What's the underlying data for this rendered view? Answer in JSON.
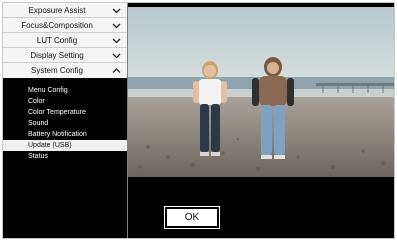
{
  "menu": {
    "items": [
      {
        "label": "Exposure Assist",
        "chevron": "chevron-down-icon"
      },
      {
        "label": "Focus&Composition",
        "chevron": "chevron-down-icon"
      },
      {
        "label": "LUT Config",
        "chevron": "chevron-down-icon"
      },
      {
        "label": "Display Setting",
        "chevron": "chevron-down-icon"
      },
      {
        "label": "System Config",
        "chevron": "chevron-up-icon"
      }
    ],
    "submenu": [
      "Menu Config",
      "Color",
      "Color Temperature",
      "Sound",
      "Battery Notification",
      "Update (USB)",
      "Status"
    ],
    "selected_submenu": "Update (USB)"
  },
  "dialog": {
    "ok_label": "OK"
  },
  "preview": {
    "scene": "beach-photo"
  }
}
